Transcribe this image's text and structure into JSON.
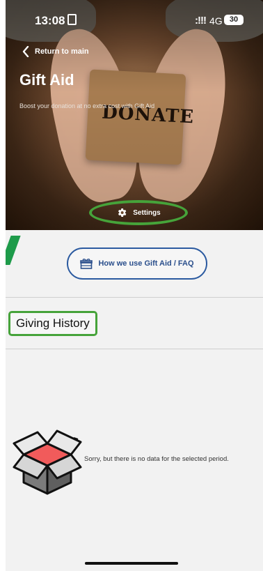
{
  "status_bar": {
    "time": "13:08",
    "signal": ":!!!",
    "network": "4G",
    "battery": "30"
  },
  "header": {
    "back_label": "Return to main",
    "title": "Gift Aid",
    "subtitle": "Boost your donation at no extra cost with Gift Aid",
    "image_text": "DONATE",
    "settings_label": "Settings"
  },
  "faq_button": {
    "label": "How we use Gift Aid / FAQ",
    "icon": "gift-icon"
  },
  "history": {
    "title": "Giving History",
    "empty_message": "Sorry, but there is no data for the selected period.",
    "empty_icon": "open-box-icon"
  },
  "colors": {
    "accent": "#2b5aa0",
    "highlight": "#46a33a",
    "box_lid": "#f15b5b"
  }
}
